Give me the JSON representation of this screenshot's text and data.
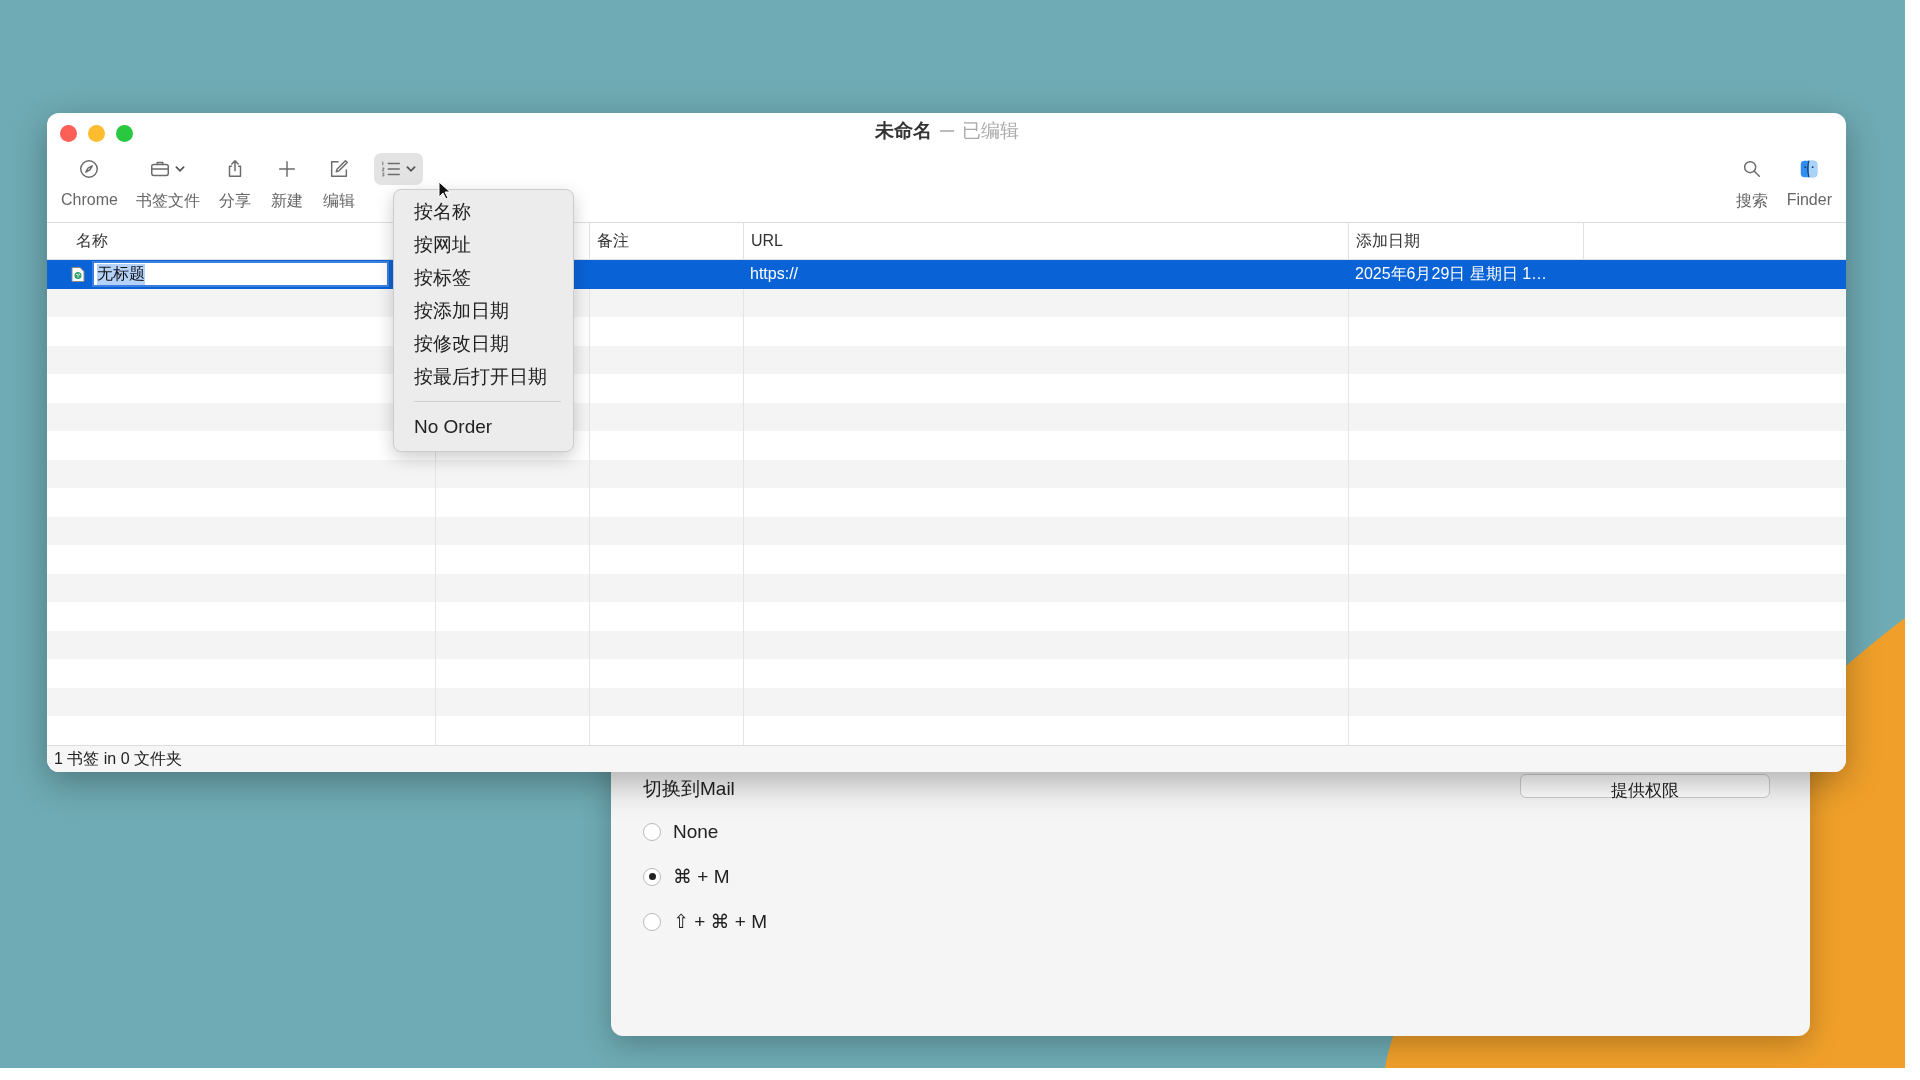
{
  "window": {
    "title": "未命名",
    "subtitle": "已编辑"
  },
  "toolbar": {
    "left": [
      {
        "kind": "compass",
        "label": "Chrome",
        "dropdown": false,
        "pressed": false
      },
      {
        "kind": "briefcase",
        "label": "书签文件",
        "dropdown": true,
        "pressed": false
      },
      {
        "kind": "share",
        "label": "分享",
        "dropdown": false,
        "pressed": false
      },
      {
        "kind": "plus",
        "label": "新建",
        "dropdown": false,
        "pressed": false
      },
      {
        "kind": "edit",
        "label": "编辑",
        "dropdown": false,
        "pressed": false
      },
      {
        "kind": "sort",
        "dropdown": true,
        "pressed": true
      }
    ],
    "right": [
      {
        "kind": "search",
        "label": "搜索"
      },
      {
        "kind": "finder",
        "label": "Finder"
      }
    ]
  },
  "table": {
    "columns": [
      {
        "label": "名称"
      },
      {},
      {
        "label": "备注"
      },
      {
        "label": "URL"
      },
      {
        "label": "添加日期"
      }
    ],
    "rows": [
      {
        "selected": true,
        "editing": true,
        "cells": [
          "无标题",
          "",
          "",
          "https://",
          "2025年6月29日 星期日 1…"
        ]
      }
    ]
  },
  "menu": {
    "items": [
      {
        "kind": "item",
        "label": "按名称"
      },
      {
        "kind": "item",
        "label": "按网址"
      },
      {
        "kind": "item",
        "label": "按标签"
      },
      {
        "kind": "item",
        "label": "按添加日期"
      },
      {
        "kind": "item",
        "label": "按修改日期"
      },
      {
        "kind": "item",
        "label": "按最后打开日期"
      },
      {
        "kind": "separator"
      },
      {
        "kind": "item",
        "label": "No Order"
      }
    ]
  },
  "status_bar": "1 书签 in 0 文件夹",
  "back_window": {
    "button": "提供权限",
    "section_label": "切换到Mail",
    "options": [
      {
        "label": "None",
        "selected": false
      },
      {
        "label": "⌘ + M",
        "selected": true
      },
      {
        "label": "⇧ + ⌘ + M",
        "selected": false
      }
    ]
  }
}
